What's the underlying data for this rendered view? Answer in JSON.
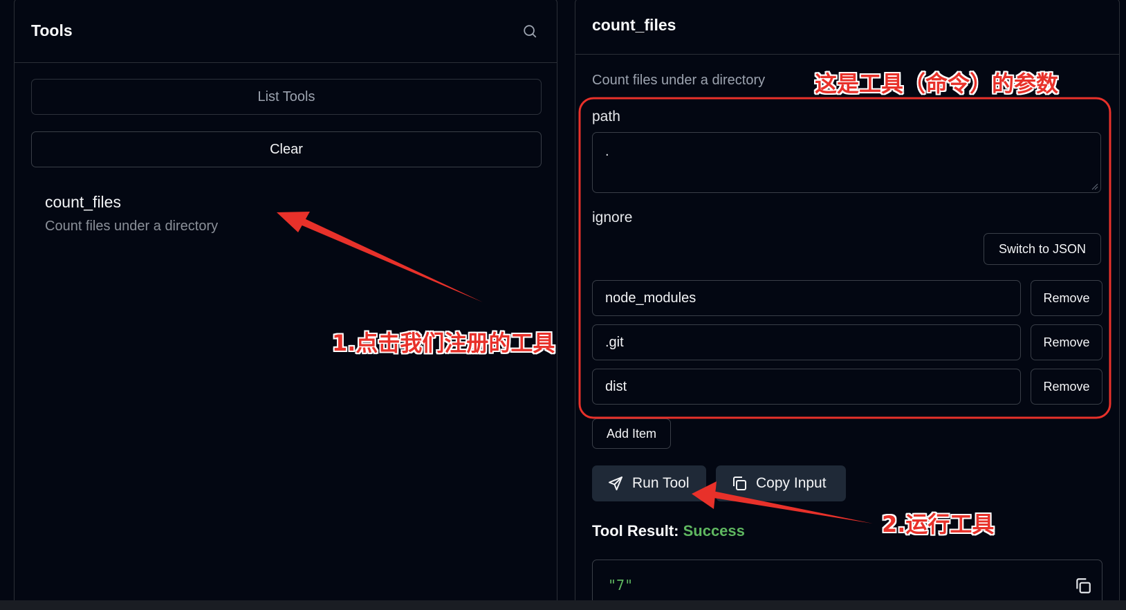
{
  "left": {
    "title": "Tools",
    "list_tools_label": "List Tools",
    "clear_label": "Clear",
    "tools": [
      {
        "name": "count_files",
        "description": "Count files under a directory"
      }
    ]
  },
  "right": {
    "title": "count_files",
    "description": "Count files under a directory",
    "params": {
      "path_label": "path",
      "path_value": ".",
      "ignore_label": "ignore",
      "switch_json_label": "Switch to JSON",
      "ignore_items": [
        {
          "value": "node_modules",
          "remove_label": "Remove"
        },
        {
          "value": ".git",
          "remove_label": "Remove"
        },
        {
          "value": "dist",
          "remove_label": "Remove"
        }
      ],
      "add_item_label": "Add Item"
    },
    "run_tool_label": "Run Tool",
    "copy_input_label": "Copy Input",
    "result_label": "Tool Result:",
    "result_status": "Success",
    "result_value": "\"7\""
  },
  "annotations": {
    "params_note": "这是工具（命令）的参数",
    "step1": "1.点击我们注册的工具",
    "step2": "2.运行工具",
    "color": "#e8312a"
  },
  "icons": [
    "search-icon",
    "send-icon",
    "copy-icon"
  ],
  "colors": {
    "background": "#030712",
    "success": "#5fb760",
    "button": "#1f2937"
  }
}
